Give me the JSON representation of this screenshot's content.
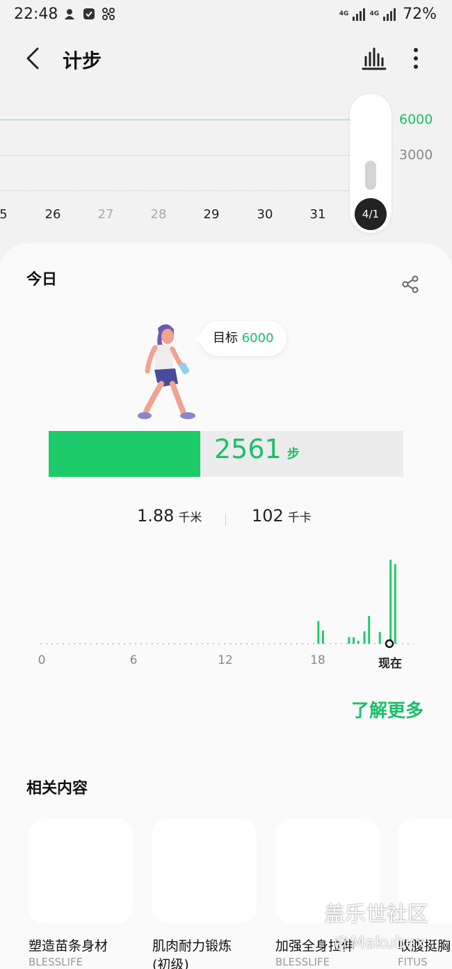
{
  "status_bar": {
    "time": "22:48",
    "net1": "4G",
    "net2": "4G",
    "battery": "72%"
  },
  "header": {
    "title": "计步"
  },
  "weekly": {
    "y_labels": [
      "6000",
      "3000"
    ],
    "days": [
      "5",
      "26",
      "27",
      "28",
      "29",
      "30",
      "31"
    ],
    "selected_date": "4/1",
    "selected_level": 0.427
  },
  "today": {
    "title": "今日",
    "goal_label": "目标",
    "goal_value": "6000",
    "steps": "2561",
    "steps_unit": "步",
    "progress": 0.427,
    "distance": "1.88",
    "distance_unit": "千米",
    "calories": "102",
    "calories_unit": "千卡"
  },
  "hourly_chart": {
    "type": "bar",
    "x_labels": [
      "0",
      "6",
      "12",
      "18",
      "现在"
    ],
    "hours": [
      18.0,
      18.3,
      20.0,
      20.3,
      20.6,
      21.0,
      21.3,
      22.0,
      22.7,
      23.0
    ],
    "values": [
      310,
      180,
      90,
      90,
      40,
      170,
      380,
      160,
      1150,
      1090
    ],
    "ylim": [
      0,
      1200
    ]
  },
  "learn_more": "了解更多",
  "related": {
    "title": "相关内容",
    "items": [
      {
        "name": "塑造苗条身材",
        "brand": "BLESSLIFE"
      },
      {
        "name": "肌肉耐力锻炼 (初级)",
        "brand": ""
      },
      {
        "name": "加强全身拉伸",
        "brand": "BLESSLIFE"
      },
      {
        "name": "收腹挺胸",
        "brand": "FITUS"
      }
    ]
  },
  "watermark": {
    "line1": "盖乐世社区",
    "line2": "@Makubex"
  },
  "colors": {
    "accent": "#1ecb6b",
    "background": "#f2f2f2",
    "card": "#fafafa"
  }
}
